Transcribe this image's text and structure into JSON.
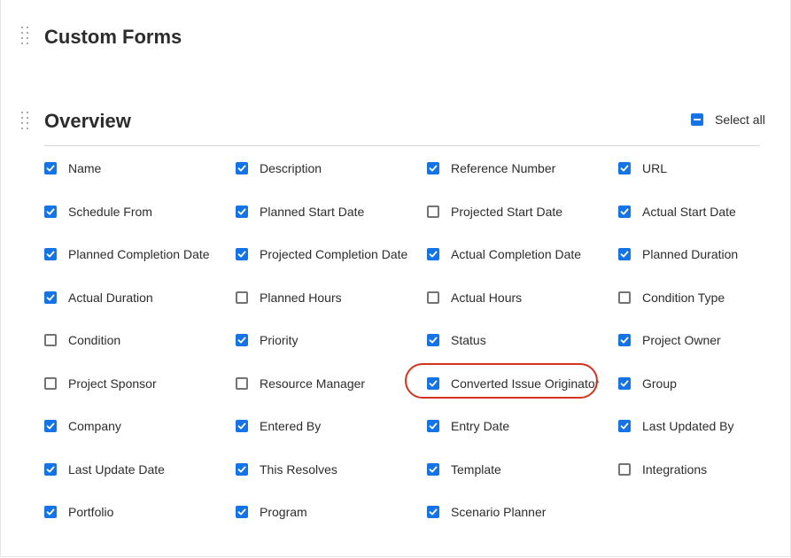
{
  "sections": {
    "custom_forms": {
      "title": "Custom Forms"
    },
    "overview": {
      "title": "Overview",
      "select_all_label": "Select all",
      "select_all_state": "indeterminate"
    }
  },
  "colors": {
    "accent": "#1473e6",
    "highlight": "#d3341e"
  },
  "fields": [
    {
      "label": "Name",
      "checked": true
    },
    {
      "label": "Description",
      "checked": true
    },
    {
      "label": "Reference Number",
      "checked": true
    },
    {
      "label": "URL",
      "checked": true
    },
    {
      "label": "Schedule From",
      "checked": true
    },
    {
      "label": "Planned Start Date",
      "checked": true
    },
    {
      "label": "Projected Start Date",
      "checked": false
    },
    {
      "label": "Actual Start Date",
      "checked": true
    },
    {
      "label": "Planned Completion Date",
      "checked": true
    },
    {
      "label": "Projected Completion Date",
      "checked": true
    },
    {
      "label": "Actual Completion Date",
      "checked": true
    },
    {
      "label": "Planned Duration",
      "checked": true
    },
    {
      "label": "Actual Duration",
      "checked": true
    },
    {
      "label": "Planned Hours",
      "checked": false
    },
    {
      "label": "Actual Hours",
      "checked": false
    },
    {
      "label": "Condition Type",
      "checked": false
    },
    {
      "label": "Condition",
      "checked": false
    },
    {
      "label": "Priority",
      "checked": true
    },
    {
      "label": "Status",
      "checked": true
    },
    {
      "label": "Project Owner",
      "checked": true
    },
    {
      "label": "Project Sponsor",
      "checked": false
    },
    {
      "label": "Resource Manager",
      "checked": false
    },
    {
      "label": "Converted Issue Originator",
      "checked": true,
      "highlighted": true
    },
    {
      "label": "Group",
      "checked": true
    },
    {
      "label": "Company",
      "checked": true
    },
    {
      "label": "Entered By",
      "checked": true
    },
    {
      "label": "Entry Date",
      "checked": true
    },
    {
      "label": "Last Updated By",
      "checked": true
    },
    {
      "label": "Last Update Date",
      "checked": true
    },
    {
      "label": "This Resolves",
      "checked": true
    },
    {
      "label": "Template",
      "checked": true
    },
    {
      "label": "Integrations",
      "checked": false
    },
    {
      "label": "Portfolio",
      "checked": true
    },
    {
      "label": "Program",
      "checked": true
    },
    {
      "label": "Scenario Planner",
      "checked": true
    }
  ]
}
